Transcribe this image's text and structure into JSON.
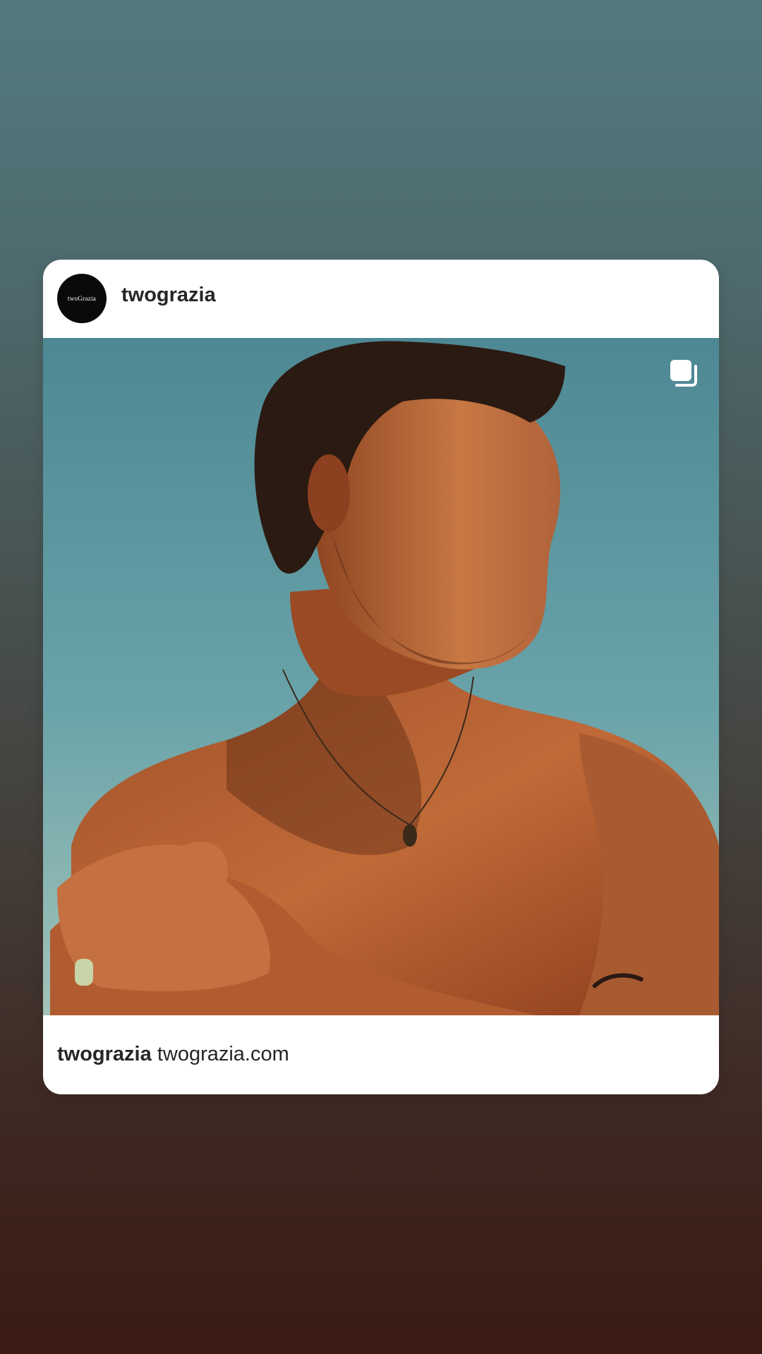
{
  "post": {
    "avatar": {
      "logo_text": "twoGrazia"
    },
    "username": "twograzia",
    "media": {
      "icon": "multiple-images-icon"
    },
    "caption": {
      "username": "twograzia",
      "text": "twograzia.com"
    }
  },
  "colors": {
    "card_background": "#ffffff",
    "text": "#262626",
    "gradient_top": "#537b7f",
    "gradient_bottom": "#3a1b13"
  }
}
